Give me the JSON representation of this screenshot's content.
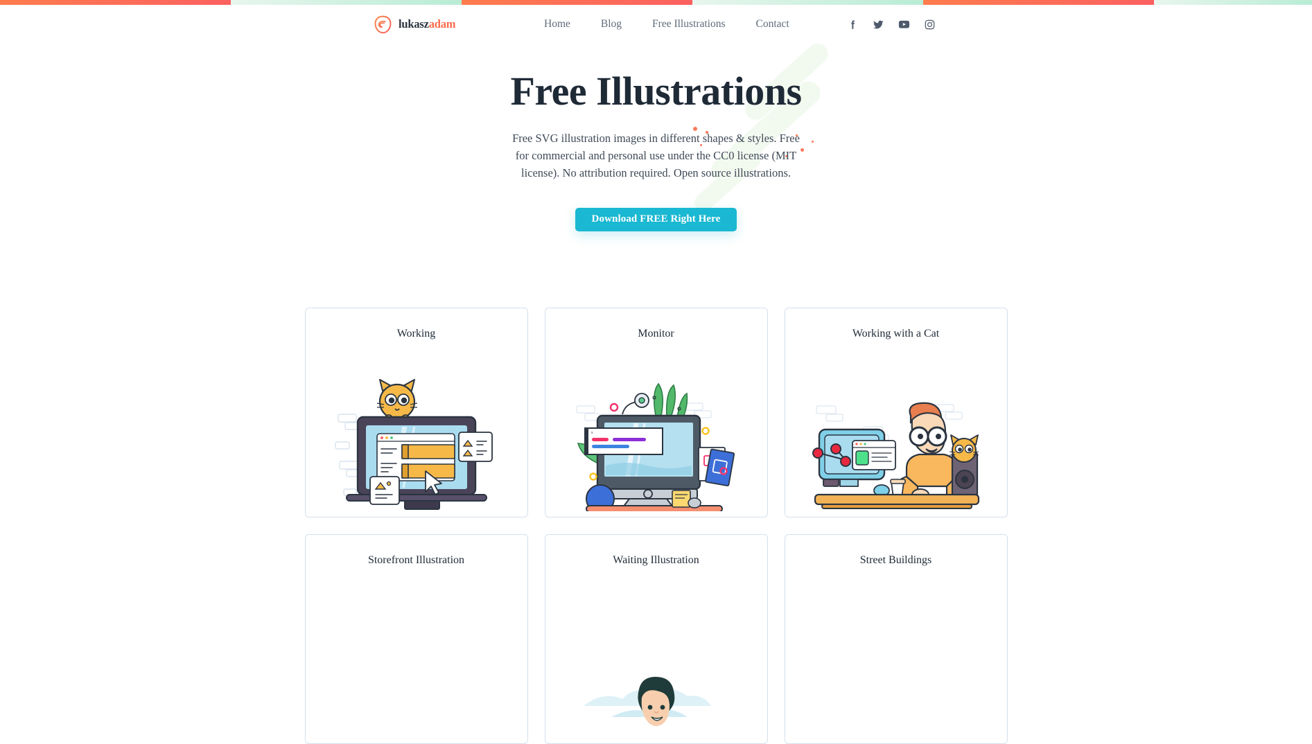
{
  "top_strip": {
    "segments": [
      "orange",
      "mint",
      "orange",
      "mint",
      "orange",
      "mint"
    ],
    "orange_color": "#fb6060",
    "mint_color": "#b9ecd4"
  },
  "header": {
    "brand": {
      "name_dark": "lukasz",
      "name_accent": "adam",
      "icon": "leaf-swirl-logo-icon"
    },
    "nav": [
      {
        "label": "Home"
      },
      {
        "label": "Blog"
      },
      {
        "label": "Free Illustrations"
      },
      {
        "label": "Contact"
      }
    ],
    "social": [
      {
        "name": "facebook-icon",
        "label": "Facebook"
      },
      {
        "name": "twitter-icon",
        "label": "Twitter"
      },
      {
        "name": "youtube-icon",
        "label": "YouTube"
      },
      {
        "name": "instagram-icon",
        "label": "Instagram"
      }
    ]
  },
  "hero": {
    "title": "Free Illustrations",
    "subtitle": "Free SVG illustration images in different shapes & styles. Free for commercial and personal use under the CC0 license (MIT license). No attribution required. Open source illustrations.",
    "cta_label": "Download FREE Right Here",
    "cta_color": "#1ab8d2",
    "accent_dot_color": "#ff7a5c",
    "decor_green_color": "#f2faf0"
  },
  "gallery": {
    "cards": [
      {
        "title": "Working",
        "art": "working"
      },
      {
        "title": "Monitor",
        "art": "monitor"
      },
      {
        "title": "Working with a Cat",
        "art": "working-with-a-cat"
      },
      {
        "title": "Storefront Illustration",
        "art": "storefront"
      },
      {
        "title": "Waiting Illustration",
        "art": "waiting"
      },
      {
        "title": "Street Buildings",
        "art": "street-buildings"
      }
    ]
  }
}
